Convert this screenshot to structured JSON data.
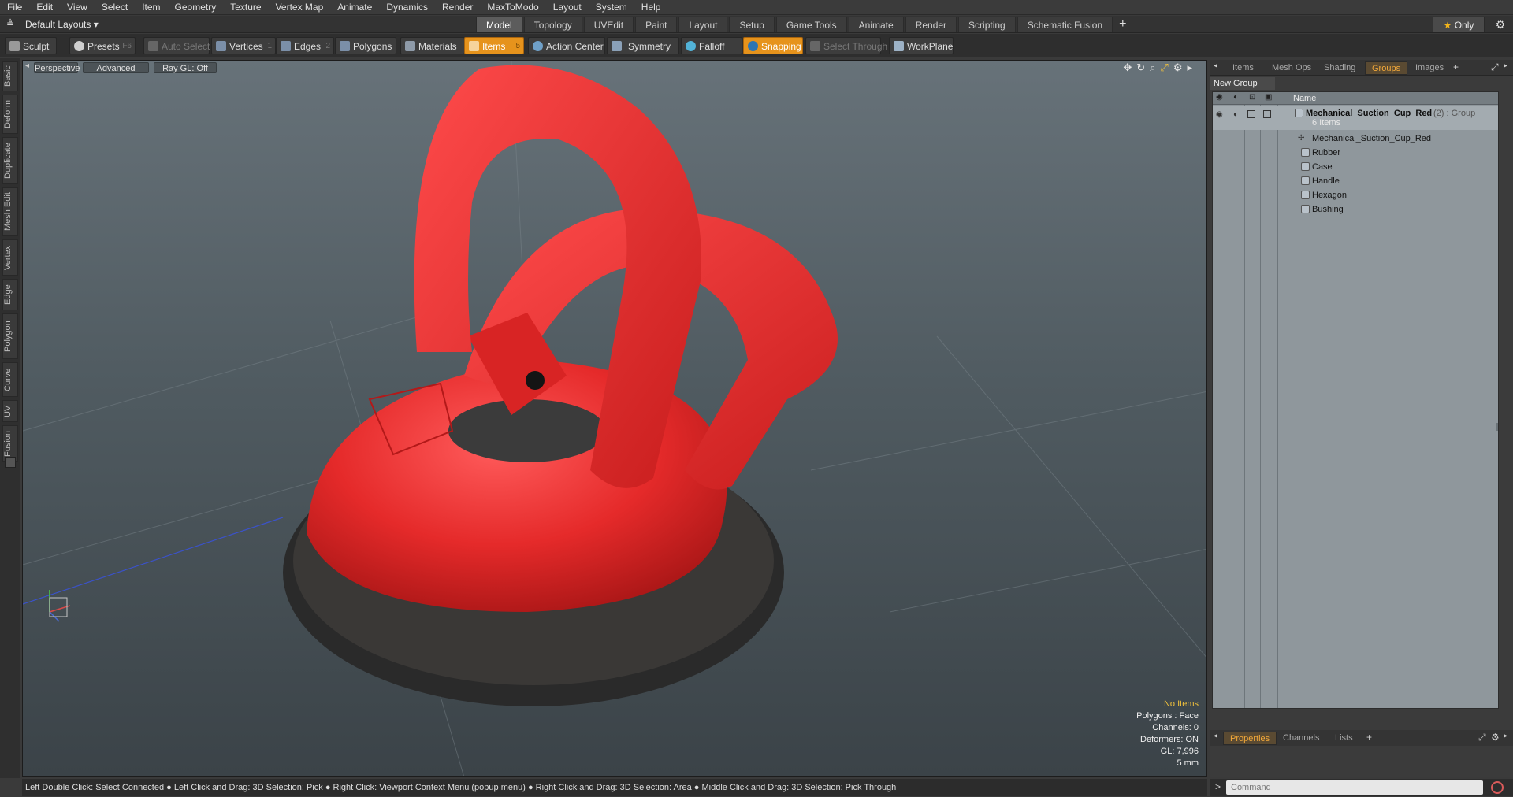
{
  "menubar": {
    "items": [
      "File",
      "Edit",
      "View",
      "Select",
      "Item",
      "Geometry",
      "Texture",
      "Vertex Map",
      "Animate",
      "Dynamics",
      "Render",
      "MaxToModo",
      "Layout",
      "System",
      "Help"
    ]
  },
  "layoutbar": {
    "layout_label": "Default Layouts",
    "tabs": [
      "Model",
      "Topology",
      "UVEdit",
      "Paint",
      "Layout",
      "Setup",
      "Game Tools",
      "Animate",
      "Render",
      "Scripting",
      "Schematic Fusion"
    ],
    "active_tab": "Model",
    "only_label": "Only"
  },
  "toolbar": {
    "sculpt": "Sculpt",
    "presets": "Presets",
    "presets_key": "F6",
    "auto_select": "Auto Select",
    "vertices": "Vertices",
    "vertices_num": "1",
    "edges": "Edges",
    "edges_num": "2",
    "polygons": "Polygons",
    "materials": "Materials",
    "items": "Items",
    "items_num": "5",
    "action_center": "Action Center",
    "symmetry": "Symmetry",
    "falloff": "Falloff",
    "snapping": "Snapping",
    "select_through": "Select Through",
    "workplane": "WorkPlane"
  },
  "lefttabs": [
    "Basic",
    "Deform",
    "Duplicate",
    "Mesh Edit",
    "Vertex",
    "Edge",
    "Polygon",
    "Curve",
    "UV",
    "Fusion"
  ],
  "viewport": {
    "view_label": "Perspective",
    "shading_label": "Advanced",
    "raygl_label": "Ray GL: Off",
    "info": {
      "items": "No Items",
      "polygons": "Polygons : Face",
      "channels": "Channels: 0",
      "deformers": "Deformers: ON",
      "gl": "GL: 7,996",
      "unit": "5 mm"
    }
  },
  "statusbar": {
    "text": "Left Double Click: Select Connected ● Left Click and Drag: 3D Selection: Pick ● Right Click: Viewport Context Menu (popup menu) ● Right Click and Drag: 3D Selection: Area ● Middle Click and Drag: 3D Selection: Pick Through"
  },
  "rightpanel": {
    "tabs": [
      "Items",
      "Mesh Ops",
      "Shading",
      "Groups",
      "Images"
    ],
    "active_tab": "Groups",
    "new_group": "New Group",
    "name_header": "Name",
    "group_name": "Mechanical_Suction_Cup_Red",
    "group_suffix": "(2) : Group",
    "group_count": "6 Items",
    "children": [
      "Mechanical_Suction_Cup_Red",
      "Rubber",
      "Case",
      "Handle",
      "Hexagon",
      "Bushing"
    ],
    "bottom_tabs": [
      "Properties",
      "Channels",
      "Lists"
    ],
    "bottom_active": "Properties",
    "command_placeholder": "Command"
  },
  "colors": {
    "accent": "#e6931c",
    "model_red": "#e52a2a",
    "viewport_bg": "#5a656b"
  }
}
